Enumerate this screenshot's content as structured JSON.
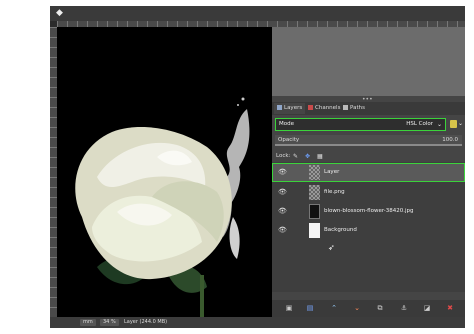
{
  "status_bar": {
    "unit": "mm",
    "zoom": "34 %",
    "text": "Layer (244.0 MB)"
  },
  "layers_panel": {
    "tabs": [
      {
        "label": "Layers",
        "icon": "layers-icon"
      },
      {
        "label": "Channels",
        "icon": "channels-icon"
      },
      {
        "label": "Paths",
        "icon": "paths-icon"
      }
    ],
    "mode_label": "Mode",
    "mode_value": "HSL Color",
    "opacity_label": "Opacity",
    "opacity_value": "100.0",
    "opacity_fraction": 1.0,
    "lock_label": "Lock:",
    "layers": [
      {
        "name": "Layer",
        "visible": true,
        "thumbnail": "checker-swirl",
        "selected": true
      },
      {
        "name": "file.png",
        "visible": true,
        "thumbnail": "checker"
      },
      {
        "name": "blown-blossom-flower-38420.jpg",
        "visible": true,
        "thumbnail": "black-flower"
      },
      {
        "name": "Background",
        "visible": true,
        "thumbnail": "white"
      }
    ],
    "bottom_buttons": [
      "new-layer-icon",
      "new-group-icon",
      "raise-icon",
      "lower-icon",
      "duplicate-icon",
      "anchor-icon",
      "mask-icon",
      "delete-icon"
    ]
  },
  "colors": {
    "highlight": "#3bd33b",
    "panel_bg": "#454545",
    "canvas_bg": "#000000"
  }
}
